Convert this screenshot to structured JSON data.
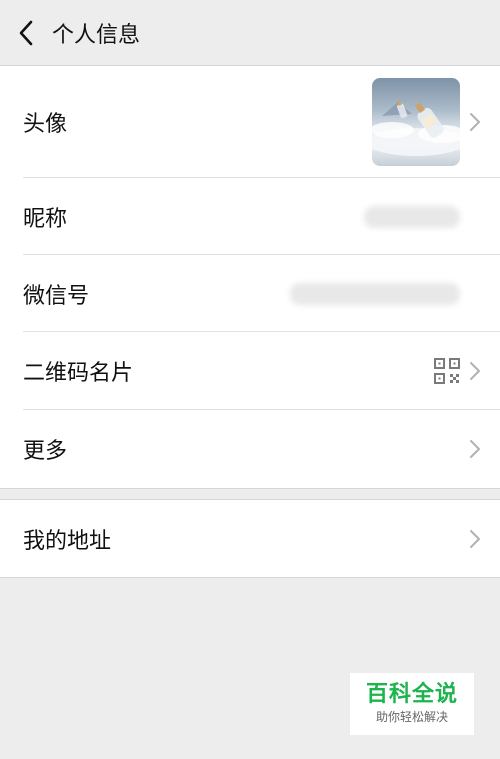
{
  "header": {
    "title": "个人信息"
  },
  "rows": {
    "avatar": {
      "label": "头像"
    },
    "nickname": {
      "label": "昵称"
    },
    "wechat_id": {
      "label": "微信号"
    },
    "qr_card": {
      "label": "二维码名片"
    },
    "more": {
      "label": "更多"
    },
    "address": {
      "label": "我的地址"
    }
  },
  "watermark": {
    "title": "百科全说",
    "subtitle": "助你轻松解决"
  },
  "colors": {
    "accent_green": "#1db34d",
    "background": "#ededed"
  },
  "icons": [
    "back-arrow-icon",
    "chevron-right-icon",
    "qr-code-icon"
  ]
}
